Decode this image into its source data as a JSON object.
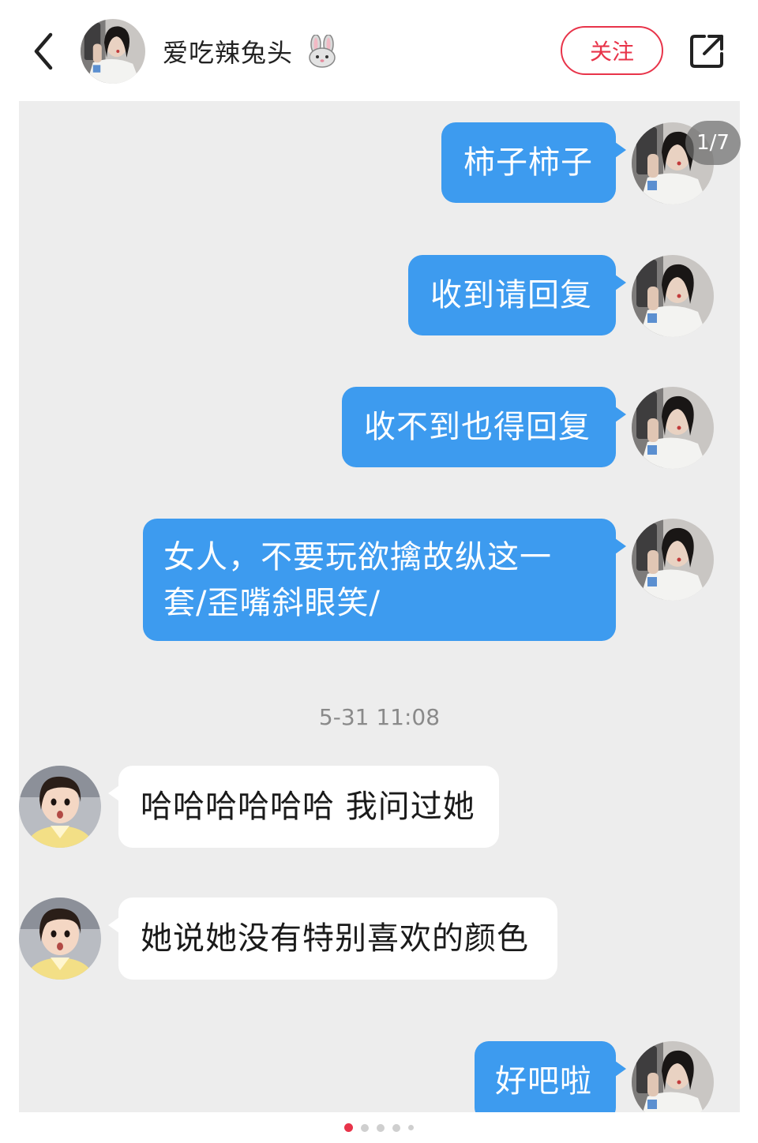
{
  "header": {
    "username": "爱吃辣兔头",
    "follow_label": "关注"
  },
  "viewer": {
    "page_counter": "1/7",
    "current_page": 1,
    "total_pages": 7
  },
  "chat": {
    "outgoing_1": "柿子柿子",
    "outgoing_2": "收到请回复",
    "outgoing_3": "收不到也得回复",
    "outgoing_4_line1": "女人，不要玩欲擒故纵这一",
    "outgoing_4_line2": "套/歪嘴斜眼笑/",
    "timestamp": "5-31 11:08",
    "incoming_1": "哈哈哈哈哈哈 我问过她",
    "incoming_2": "她说她没有特别喜欢的颜色",
    "outgoing_5": "好吧啦"
  },
  "colors": {
    "accent": "#e8344a",
    "outgoing_bubble": "#3d9bef",
    "incoming_bubble": "#ffffff",
    "chat_background": "#ededed"
  },
  "icons": {
    "back": "chevron-left-icon",
    "share": "share-icon",
    "emoji": "rabbit-emoji"
  }
}
